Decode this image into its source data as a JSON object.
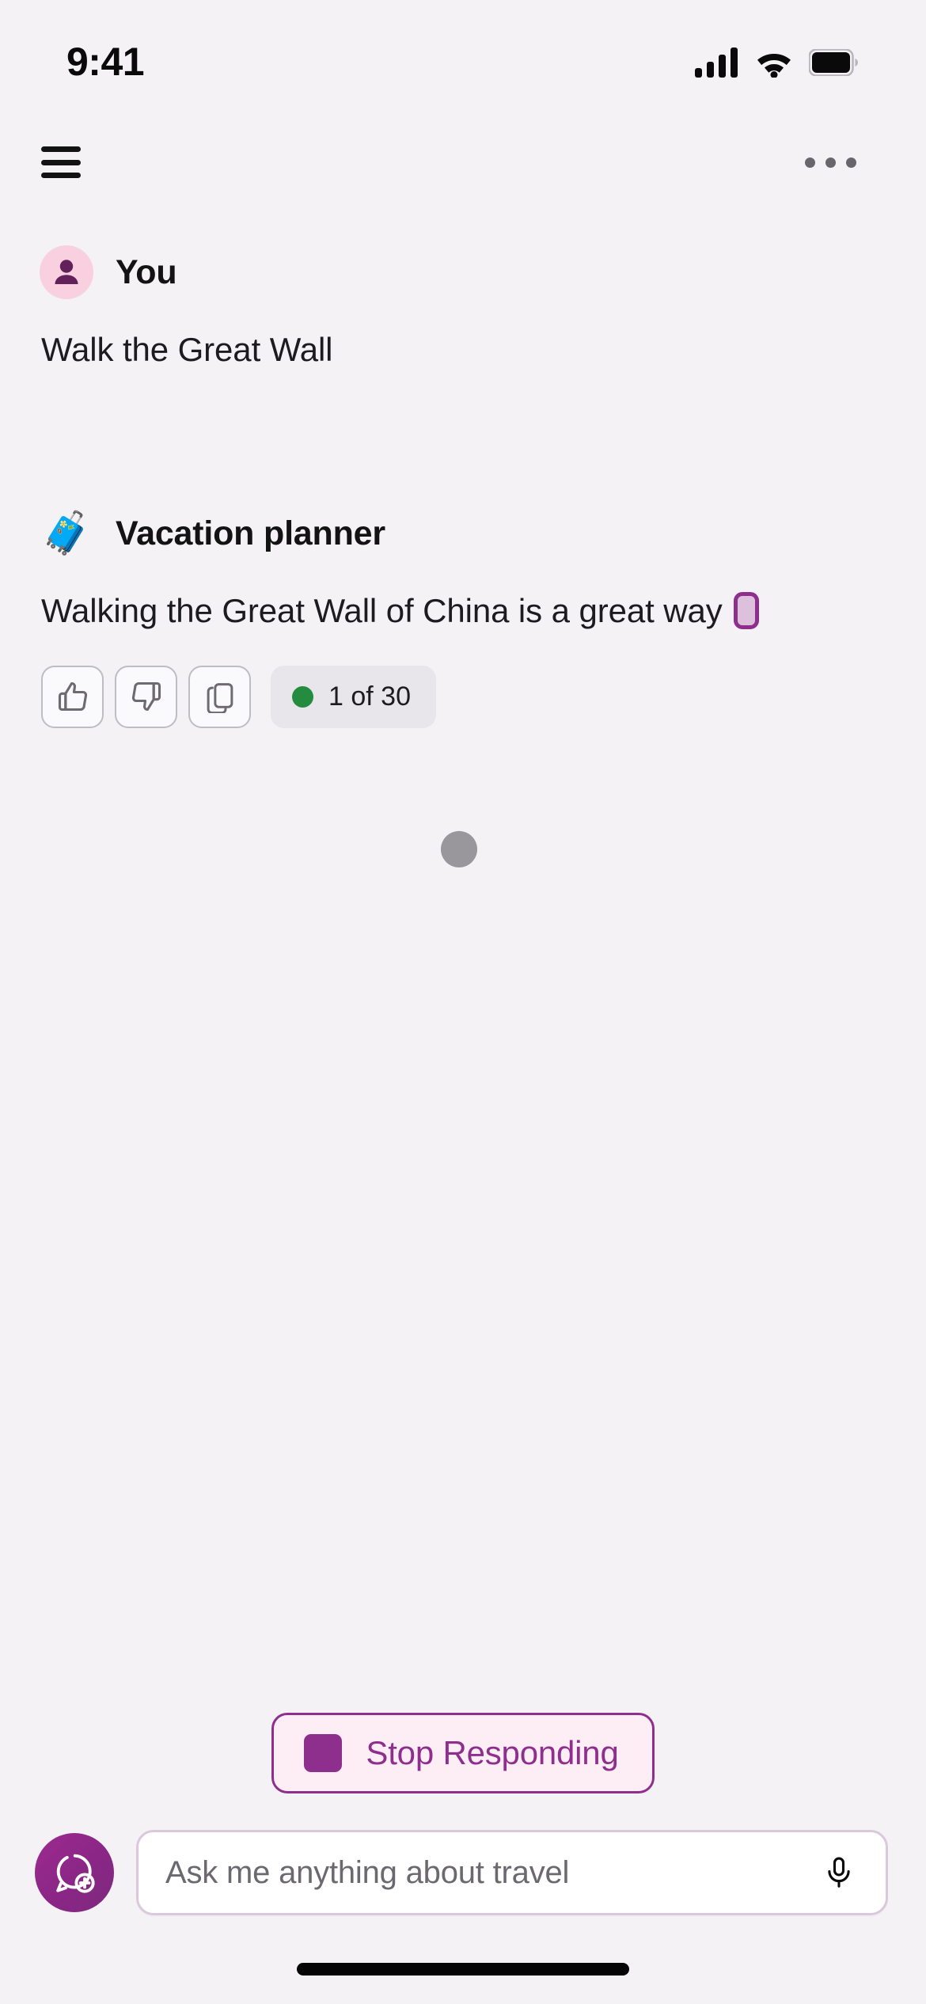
{
  "status_bar": {
    "time": "9:41",
    "cellular_icon": "cellular-signal-icon",
    "wifi_icon": "wifi-icon",
    "battery_icon": "battery-full-icon"
  },
  "nav_bar": {
    "menu_icon": "hamburger-menu-icon",
    "more_icon": "more-options-icon"
  },
  "conversation": {
    "messages": [
      {
        "sender": "You",
        "avatar_icon": "person-avatar-icon",
        "avatar_bg": "#f8d0e0",
        "avatar_fg": "#63215c",
        "text": "Walk the Great Wall"
      },
      {
        "sender": "Vacation planner",
        "avatar_icon": "luggage-emoji",
        "avatar_emoji": "🧳",
        "text": "Walking the Great Wall of China is a great way",
        "streaming": true
      }
    ],
    "actions": {
      "thumbs_up_icon": "thumbs-up-icon",
      "thumbs_down_icon": "thumbs-down-icon",
      "copy_icon": "copy-icon",
      "counter_text": "1 of 30",
      "counter_dot_color": "#238c3f"
    },
    "typing_indicator": {
      "icon": "typing-indicator-dot",
      "color": "#99969c"
    }
  },
  "stop_responding": {
    "label": "Stop Responding",
    "icon": "stop-square-icon",
    "accent_color": "#8e2f8e",
    "background_color": "#fdeef6"
  },
  "composer": {
    "new_chat_icon": "new-chat-bubble-plus-icon",
    "new_chat_bg": "#8a2686",
    "input_value": "",
    "placeholder": "Ask me anything about travel",
    "mic_icon": "microphone-icon"
  },
  "home_indicator": {
    "icon": "home-indicator-bar"
  }
}
